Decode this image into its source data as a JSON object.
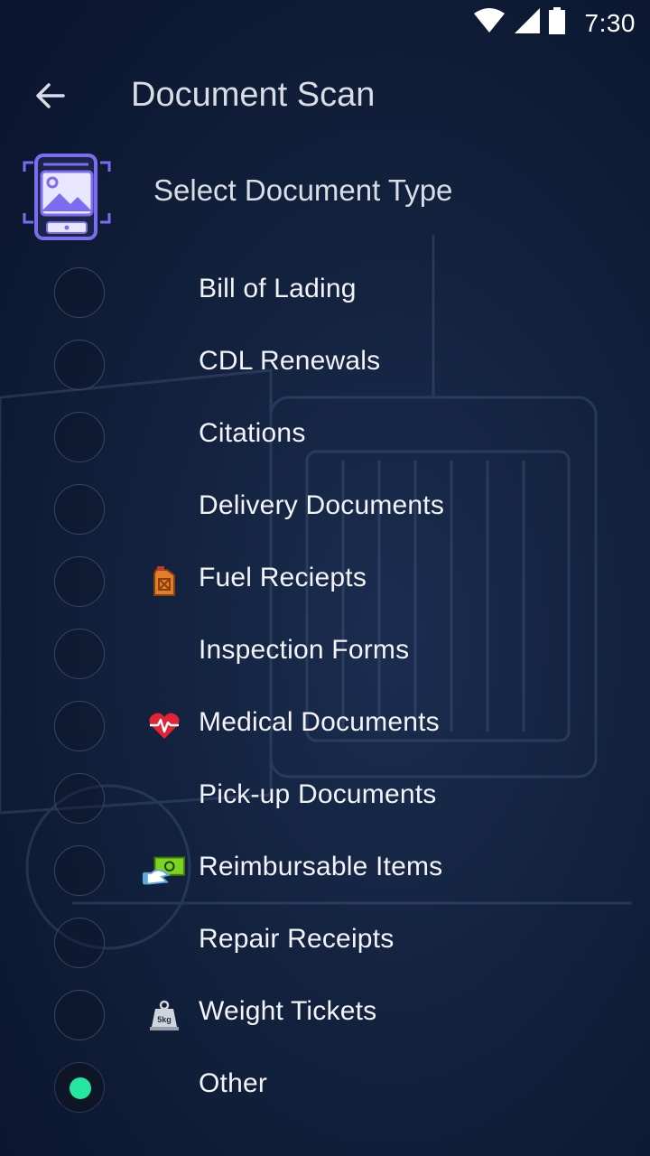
{
  "status_bar": {
    "time": "7:30"
  },
  "app_bar": {
    "title": "Document Scan"
  },
  "section": {
    "title": "Select Document Type"
  },
  "document_types": [
    {
      "label": "Bill of Lading",
      "icon": "",
      "selected": false
    },
    {
      "label": "CDL Renewals",
      "icon": "",
      "selected": false
    },
    {
      "label": "Citations",
      "icon": "",
      "selected": false
    },
    {
      "label": "Delivery Documents",
      "icon": "",
      "selected": false
    },
    {
      "label": "Fuel Reciepts",
      "icon": "fuel-can-icon",
      "selected": false
    },
    {
      "label": "Inspection Forms",
      "icon": "",
      "selected": false
    },
    {
      "label": "Medical Documents",
      "icon": "heart-pulse-icon",
      "selected": false
    },
    {
      "label": "Pick-up Documents",
      "icon": "",
      "selected": false
    },
    {
      "label": "Reimbursable Items",
      "icon": "cash-hand-icon",
      "selected": false
    },
    {
      "label": "Repair Receipts",
      "icon": "",
      "selected": false
    },
    {
      "label": "Weight Tickets",
      "icon": "weight-5kg-icon",
      "selected": false
    },
    {
      "label": "Other",
      "icon": "",
      "selected": true
    }
  ],
  "colors": {
    "selected_dot": "#25e6a1",
    "accent_icon": "#7b6cf0"
  }
}
